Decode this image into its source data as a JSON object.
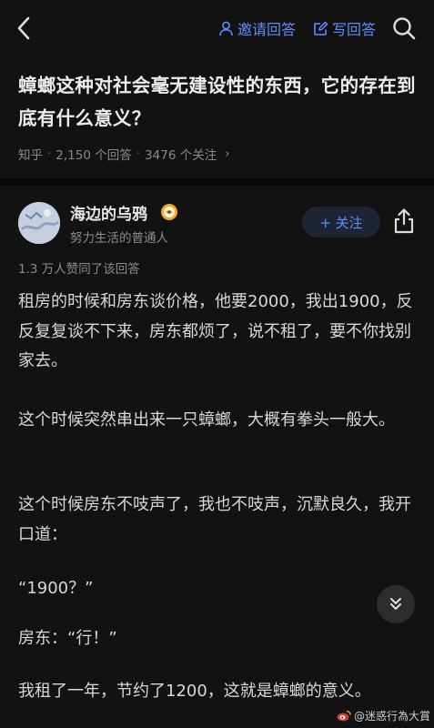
{
  "nav": {
    "invite_label": "邀请回答",
    "write_label": "写回答"
  },
  "question": {
    "title": "蟑螂这种对社会毫无建设性的东西，它的存在到底有什么意义？",
    "source": "知乎",
    "answers": "2,150 个回答",
    "followers": "3476 个关注",
    "chevron": "›"
  },
  "author": {
    "name": "海边的乌鸦",
    "bio": "努力生活的普通人",
    "follow_label": "+ 关注"
  },
  "answer": {
    "upvotes": "1.3 万人赞同了该回答",
    "paragraphs": [
      "租房的时候和房东谈价格，他要2000，我出1900，反反复复谈不下来，房东都烦了，说不租了，要不你找别家去。",
      "这个时候突然串出来一只蟑螂，大概有拳头一般大。",
      "这个时候房东不吱声了，我也不吱声，沉默良久，我开口道：",
      "“1900？”",
      "房东：“行！”",
      "我租了一年，节约了1200，这就是蟑螂的意义。"
    ]
  },
  "watermark": {
    "text": "@迷惑行為大賞"
  },
  "colors": {
    "background": "#121212",
    "accent": "#5f8dff",
    "text": "#d8d8d8",
    "muted": "#8a8a8a"
  },
  "icons": [
    "back-icon",
    "person-icon",
    "edit-icon",
    "search-icon",
    "badge-icon",
    "share-icon",
    "chevron-down-icon",
    "weibo-icon"
  ]
}
